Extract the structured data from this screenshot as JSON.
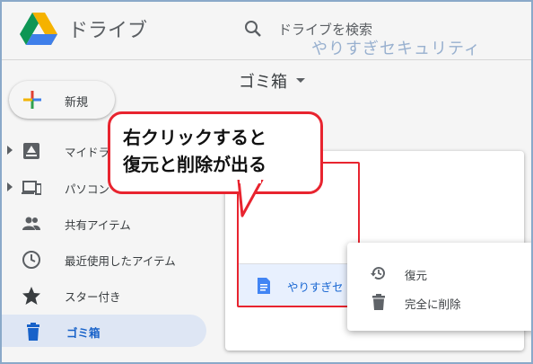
{
  "app": {
    "title": "ドライブ"
  },
  "search": {
    "placeholder": "ドライブを検索"
  },
  "watermark": "やりすぎセキュリティ",
  "breadcrumb": {
    "label": "ゴミ箱"
  },
  "new_button": {
    "label": "新規"
  },
  "sidebar": {
    "items": [
      {
        "label": "マイドライブ",
        "icon": "my-drive-icon",
        "expandable": true
      },
      {
        "label": "パソコン",
        "icon": "computer-icon",
        "expandable": true
      },
      {
        "label": "共有アイテム",
        "icon": "people-icon",
        "expandable": false
      },
      {
        "label": "最近使用したアイテム",
        "icon": "clock-icon",
        "expandable": false
      },
      {
        "label": "スター付き",
        "icon": "star-icon",
        "expandable": false
      },
      {
        "label": "ゴミ箱",
        "icon": "trash-icon",
        "expandable": false,
        "active": true
      }
    ]
  },
  "file": {
    "name": "やりすぎセ",
    "icon": "doc-icon"
  },
  "context_menu": {
    "items": [
      {
        "label": "復元",
        "icon": "restore-icon"
      },
      {
        "label": "完全に削除",
        "icon": "trash-icon"
      }
    ]
  },
  "callout": {
    "line1": "右クリックすると",
    "line2": "復元と削除が出る"
  },
  "colors": {
    "accent": "#e8242f",
    "active_bg": "#e8f0fe",
    "active_text": "#1967d2"
  }
}
